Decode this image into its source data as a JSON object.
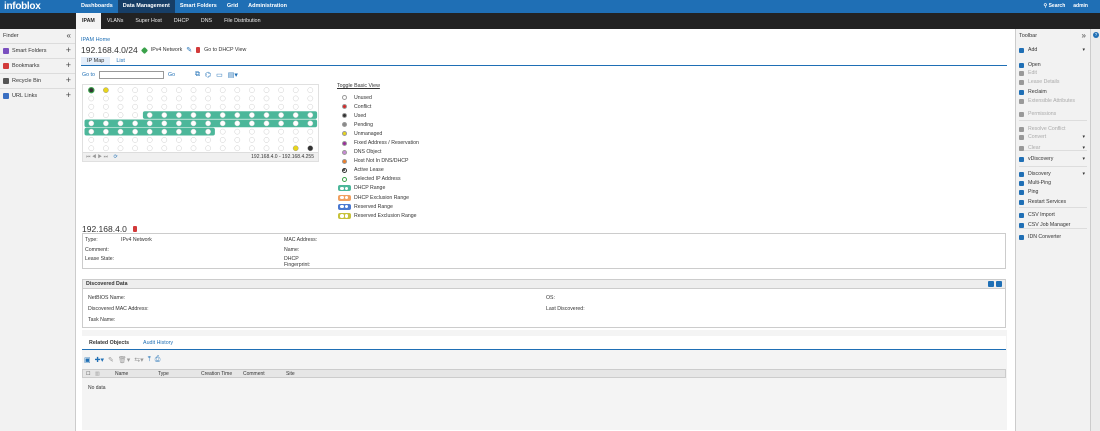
{
  "topbar": {
    "logo": "infoblox",
    "nav": [
      "Dashboards",
      "Data Management",
      "Smart Folders",
      "Grid",
      "Administration"
    ],
    "search": "Search",
    "user": "admin"
  },
  "subnav": [
    "IPAM",
    "VLANs",
    "Super Host",
    "DHCP",
    "DNS",
    "File Distribution"
  ],
  "finder": {
    "title": "Finder",
    "items": [
      {
        "label": "Smart Folders",
        "color": "#7a4fbf"
      },
      {
        "label": "Bookmarks",
        "color": "#d23a3a"
      },
      {
        "label": "Recycle Bin",
        "color": "#555555"
      },
      {
        "label": "URL Links",
        "color": "#3a6fc2"
      }
    ]
  },
  "main": {
    "breadcrumb": "IPAM Home",
    "title": "192.168.4.0/24",
    "type_label": "IPv4 Network",
    "dhcp_link": "Go to DHCP View",
    "tabs": [
      "IP Map",
      "List"
    ],
    "goto_label": "Go to",
    "goto_value": "",
    "go_button": "Go",
    "range_label": "192.168.4.0 - 192.168.4.255"
  },
  "legend": {
    "toggle": "Toggle Basic View",
    "items": [
      {
        "label": "Unused",
        "kind": "dot",
        "color": "#ffffff"
      },
      {
        "label": "Conflict",
        "kind": "dot",
        "color": "#d42b2b"
      },
      {
        "label": "Used",
        "kind": "dot",
        "color": "#333333"
      },
      {
        "label": "Pending",
        "kind": "dot",
        "color": "#8a8a8a"
      },
      {
        "label": "Unmanaged",
        "kind": "dot",
        "color": "#e8d51c"
      },
      {
        "label": "Fixed Address / Reservation",
        "kind": "dot",
        "color": "#9b2d9b"
      },
      {
        "label": "DNS Object",
        "kind": "dot",
        "color": "#c98ad6"
      },
      {
        "label": "Host Not In DNS/DHCP",
        "kind": "dot",
        "color": "#ef7f2a"
      },
      {
        "label": "Active Lease",
        "kind": "active",
        "color": "#333333"
      },
      {
        "label": "Selected IP Address",
        "kind": "selected",
        "color": "#3aa14a"
      },
      {
        "label": "DHCP Range",
        "kind": "range",
        "color": "#4cb79a"
      },
      {
        "label": "DHCP Exclusion Range",
        "kind": "range",
        "color": "#f0a060"
      },
      {
        "label": "Reserved Range",
        "kind": "range",
        "color": "#4a78d0"
      },
      {
        "label": "Reserved Exclusion Range",
        "kind": "range",
        "color": "#c7c23a"
      }
    ]
  },
  "address": {
    "title": "192.168.4.0",
    "type_label": "Type:",
    "type_value": "IPv4 Network",
    "comment_label": "Comment:",
    "lease_label": "Lease State:",
    "mac_label": "MAC Address:",
    "name_label": "Name:",
    "dhcp_fp_label": "DHCP Fingerprint:"
  },
  "discovered": {
    "title": "Discovered Data",
    "netbios": "NetBIOS Name:",
    "mac": "Discovered MAC Address:",
    "task": "Task Name:",
    "os": "OS:",
    "last": "Last Discovered:"
  },
  "related": {
    "tabs": [
      "Related Objects",
      "Audit History"
    ],
    "columns": [
      "Name",
      "Type",
      "Creation Time",
      "Comment",
      "Site"
    ],
    "empty": "No data"
  },
  "toolbar": {
    "title": "Toolbar",
    "items": [
      {
        "label": "Add",
        "enabled": true,
        "dropdown": true
      },
      {
        "label": "Open",
        "enabled": true
      },
      {
        "label": "Edit",
        "enabled": false
      },
      {
        "label": "Lease Details",
        "enabled": false
      },
      {
        "label": "Reclaim",
        "enabled": true
      },
      {
        "label": "Extensible Attributes",
        "enabled": false
      },
      {
        "label": "Permissions",
        "enabled": false
      },
      {
        "label": "Resolve Conflict",
        "enabled": false
      },
      {
        "label": "Convert",
        "enabled": false,
        "dropdown": true
      },
      {
        "label": "Clear",
        "enabled": false,
        "dropdown": true
      },
      {
        "label": "vDiscovery",
        "enabled": true,
        "dropdown": true
      },
      {
        "label": "Discovery",
        "enabled": true,
        "dropdown": true
      },
      {
        "label": "Multi-Ping",
        "enabled": true
      },
      {
        "label": "Ping",
        "enabled": true
      },
      {
        "label": "Restart Services",
        "enabled": true
      },
      {
        "label": "CSV Import",
        "enabled": true
      },
      {
        "label": "CSV Job Manager",
        "enabled": true
      },
      {
        "label": "IDN Converter",
        "enabled": true
      }
    ]
  }
}
